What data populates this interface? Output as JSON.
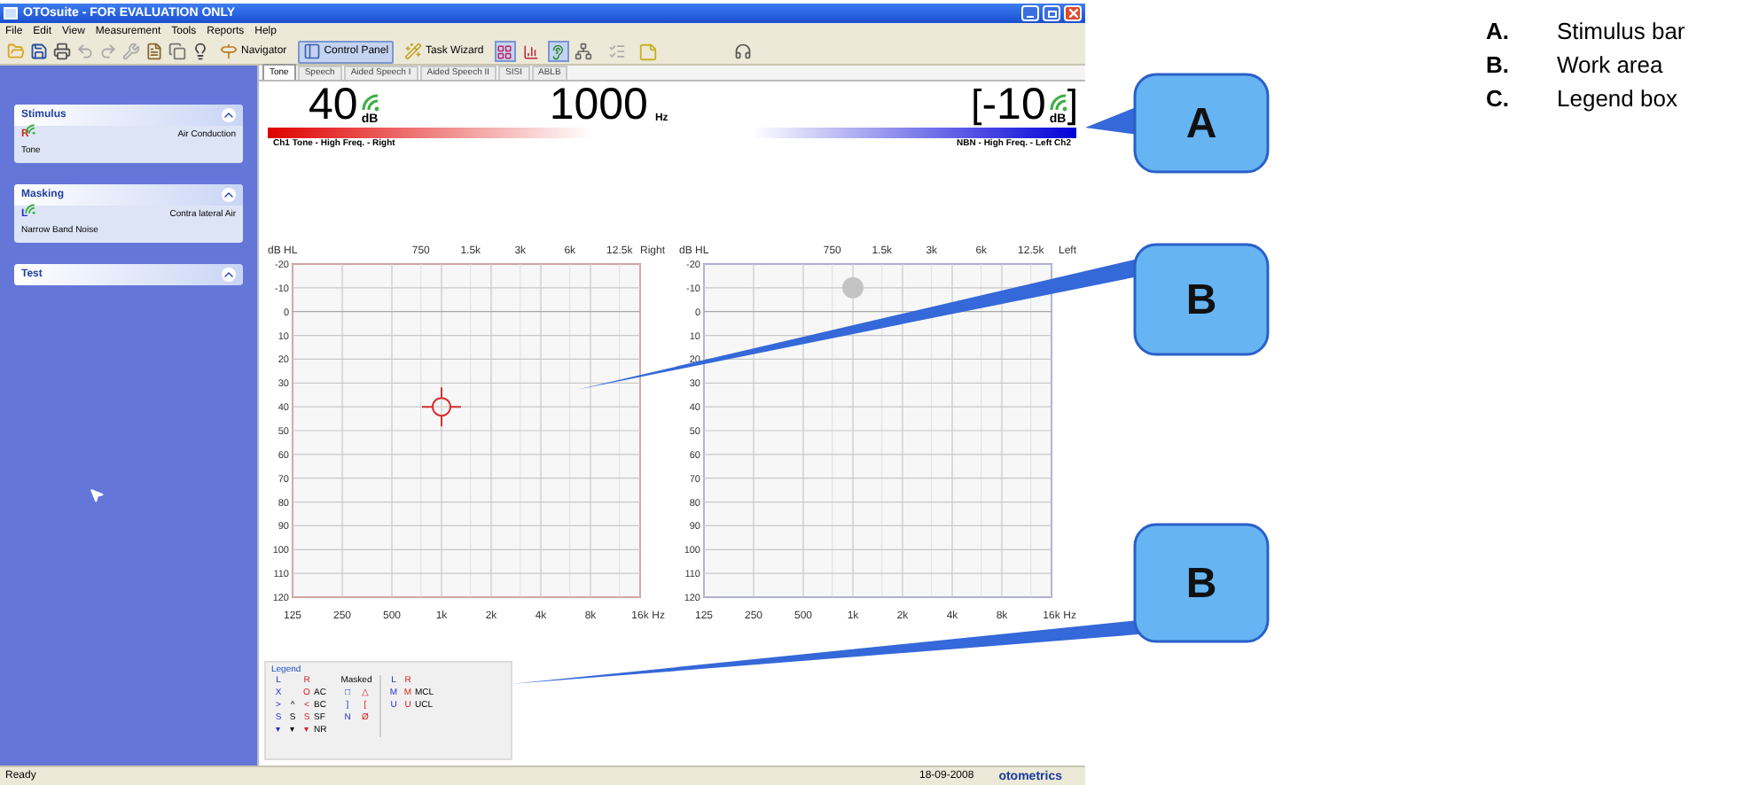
{
  "window": {
    "title": "OTOsuite - FOR EVALUATION ONLY"
  },
  "menu": [
    "File",
    "Edit",
    "View",
    "Measurement",
    "Tools",
    "Reports",
    "Help"
  ],
  "toolbar": {
    "buttons": [
      {
        "label": "Navigator",
        "pressed": false
      },
      {
        "label": "Control Panel",
        "pressed": true
      },
      {
        "label": "Task Wizard",
        "pressed": false
      }
    ],
    "view_toggles": [
      {
        "pressed": true
      },
      {
        "pressed": false
      },
      {
        "pressed": true
      }
    ]
  },
  "sidebar": {
    "panels": [
      {
        "title": "Stimulus",
        "channel": "R",
        "color": "#d82020",
        "transducer": "Air Conduction",
        "signal": "Tone"
      },
      {
        "title": "Masking",
        "channel": "L",
        "color": "#2030d0",
        "transducer": "Contra lateral Air",
        "signal": "Narrow Band Noise"
      },
      {
        "title": "Test"
      }
    ]
  },
  "tabs": [
    {
      "label": "Tone",
      "selected": true
    },
    {
      "label": "Speech",
      "selected": false
    },
    {
      "label": "Aided Speech I",
      "selected": false
    },
    {
      "label": "Aided Speech II",
      "selected": false
    },
    {
      "label": "SISI",
      "selected": false
    },
    {
      "label": "ABLB",
      "selected": false
    }
  ],
  "stimulus_bar": {
    "intensity": "40",
    "intensity_unit": "dB",
    "frequency": "1000",
    "frequency_unit": "Hz",
    "masking_open": "[",
    "masking": "-10",
    "masking_unit": "dB",
    "masking_close": "]",
    "channel_1": "Ch1  Tone - High Freq. - Right",
    "channel_2": "NBN - High Freq. - Left  Ch2"
  },
  "audiograms": [
    {
      "color": "#e08080",
      "intermediate_labels": [
        "750",
        "1.5k",
        "3k",
        "6k",
        "12.5k"
      ],
      "chart_data": {
        "type": "scatter",
        "title": "Right",
        "xlabel": "Hz",
        "ylabel": "dB HL",
        "categories": [
          "125",
          "250",
          "500",
          "1k",
          "2k",
          "4k",
          "8k",
          "16k"
        ],
        "series": [
          {
            "color": "#d83030",
            "values": [
              null,
              null,
              null,
              40,
              null,
              null,
              null,
              null
            ]
          }
        ],
        "ylim": [
          120,
          -20
        ],
        "grid": true,
        "yticks": [
          -20,
          -10,
          0,
          10,
          20,
          30,
          40,
          50,
          60,
          70,
          80,
          90,
          100,
          110,
          120
        ]
      }
    },
    {
      "color": "#9898dc",
      "intermediate_labels": [
        "750",
        "1.5k",
        "3k",
        "6k",
        "12.5k"
      ],
      "chart_data": {
        "type": "scatter",
        "title": "Left",
        "xlabel": "Hz",
        "ylabel": "dB HL",
        "categories": [
          "125",
          "250",
          "500",
          "1k",
          "2k",
          "4k",
          "8k",
          "16k"
        ],
        "series": [
          {
            "color": "#c4c4c4",
            "marker": "circle",
            "values": [
              null,
              null,
              null,
              -10,
              null,
              null,
              null,
              null
            ]
          }
        ],
        "ylim": [
          120,
          -20
        ],
        "grid": true,
        "yticks": [
          -20,
          -10,
          0,
          10,
          20,
          30,
          40,
          50,
          60,
          70,
          80,
          90,
          100,
          110,
          120
        ]
      }
    }
  ],
  "legend": {
    "title": "Legend",
    "header": {
      "left": "L",
      "right": "R",
      "masked": "Masked"
    },
    "rows": [
      {
        "left": "X",
        "right": "O",
        "label": "AC",
        "masked_left": "□",
        "masked_right": "△"
      },
      {
        "left": ">",
        "both": "^",
        "right": "<",
        "label": "BC",
        "masked_left": "]",
        "masked_right": "["
      },
      {
        "left": "S",
        "both": "S",
        "right": "S",
        "label": "SF",
        "masked_left": "N",
        "masked_right": "Ø"
      },
      {
        "left": "▾",
        "both": "▾",
        "right": "▾",
        "label": "NR"
      }
    ],
    "levels": {
      "header": {
        "left": "L",
        "right": "R"
      },
      "rows": [
        {
          "left": "M",
          "right": "M",
          "label": "MCL"
        },
        {
          "left": "U",
          "right": "U",
          "label": "UCL"
        }
      ]
    }
  },
  "status_bar": {
    "status": "Ready",
    "date": "18-09-2008",
    "brand": "otometrics"
  },
  "callouts": [
    {
      "label": "A"
    },
    {
      "label": "B"
    },
    {
      "label": "B"
    }
  ],
  "key": [
    {
      "letter": "A.",
      "text": "Stimulus bar"
    },
    {
      "letter": "B.",
      "text": "Work area"
    },
    {
      "letter": "C.",
      "text": "Legend box"
    }
  ]
}
